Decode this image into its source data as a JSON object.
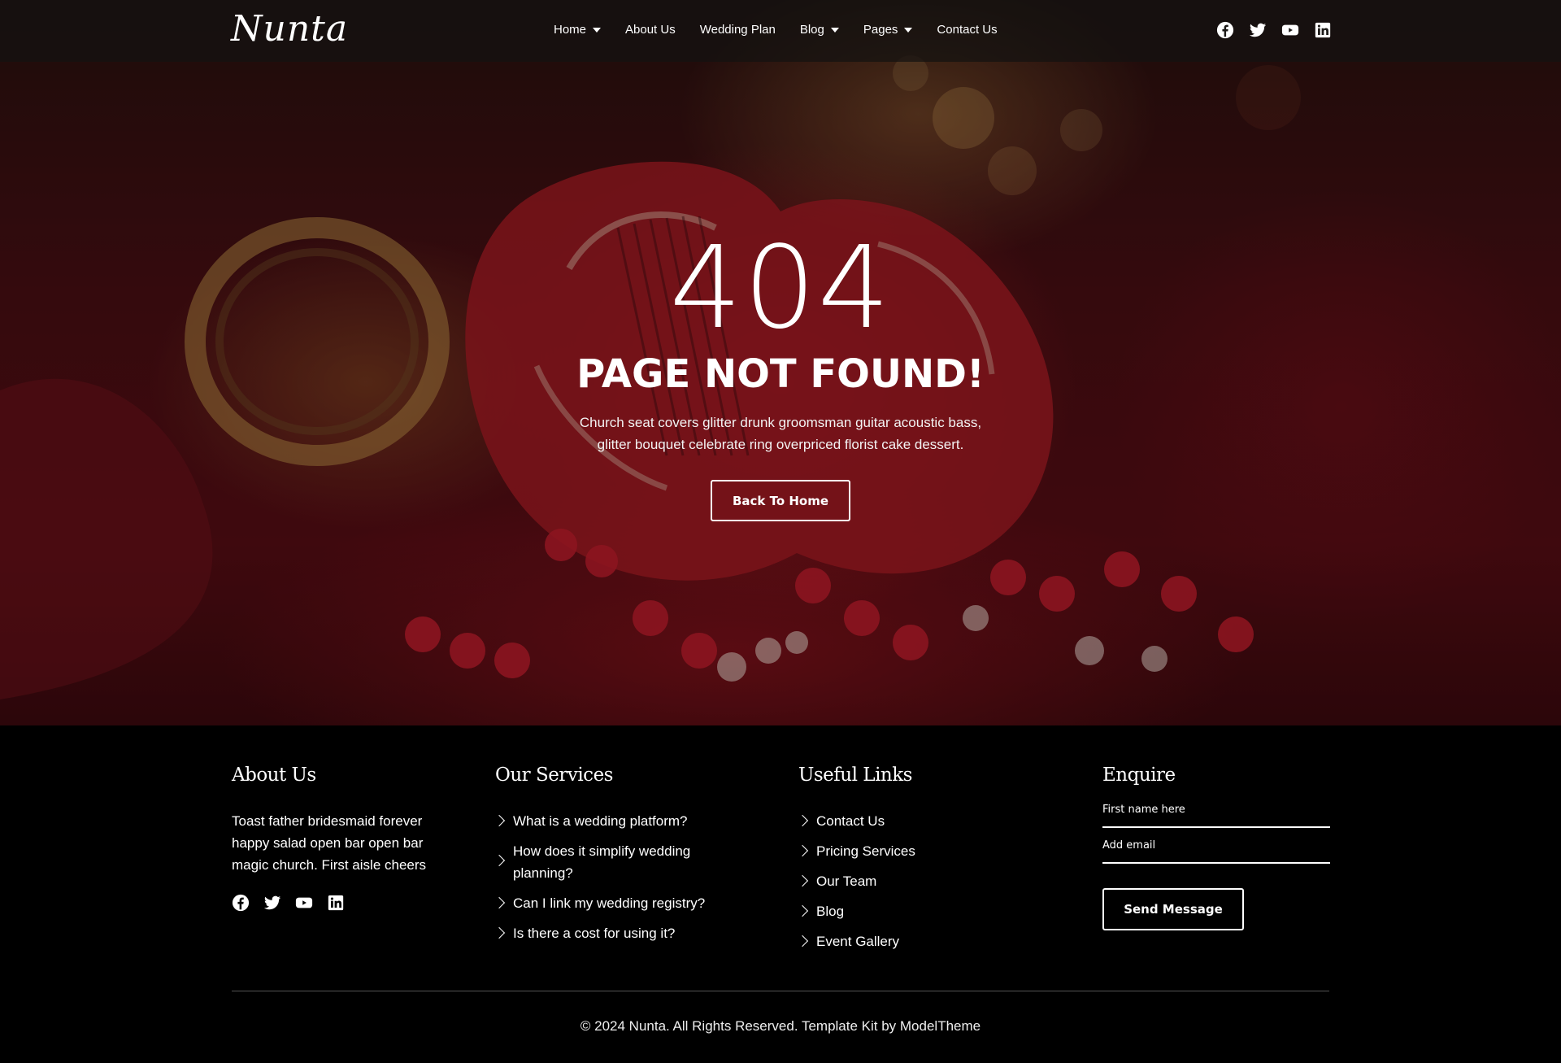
{
  "header": {
    "logo": "Nunta",
    "nav": [
      {
        "label": "Home",
        "has_dropdown": true
      },
      {
        "label": "About Us",
        "has_dropdown": false
      },
      {
        "label": "Wedding Plan",
        "has_dropdown": false
      },
      {
        "label": "Blog",
        "has_dropdown": true
      },
      {
        "label": "Pages",
        "has_dropdown": true
      },
      {
        "label": "Contact Us",
        "has_dropdown": false
      }
    ],
    "social_icons": [
      "facebook-icon",
      "twitter-icon",
      "youtube-icon",
      "linkedin-icon"
    ]
  },
  "hero": {
    "code": "404",
    "title": "PAGE NOT FOUND!",
    "text": "Church seat covers glitter drunk groomsman guitar acoustic bass, glitter bouquet celebrate ring overpriced florist cake dessert.",
    "button": "Back To Home"
  },
  "footer": {
    "about": {
      "heading": "About Us",
      "text": "Toast father bridesmaid forever happy salad open bar open bar magic church. First aisle cheers",
      "social_icons": [
        "facebook-icon",
        "twitter-icon",
        "youtube-icon",
        "linkedin-icon"
      ]
    },
    "services": {
      "heading": "Our Services",
      "items": [
        "What is a wedding platform?",
        "How does it simplify wedding planning?",
        "Can I link my wedding registry?",
        "Is there a cost for using it?"
      ]
    },
    "links": {
      "heading": "Useful Links",
      "items": [
        "Contact Us",
        "Pricing Services",
        "Our Team",
        "Blog",
        "Event Gallery"
      ]
    },
    "enquire": {
      "heading": "Enquire",
      "name_placeholder": "First name here",
      "email_placeholder": "Add email",
      "button": "Send Message"
    },
    "copyright": "© 2024 Nunta. All Rights Reserved. Template Kit by ModelTheme"
  },
  "colors": {
    "background": "#000000",
    "hero_red": "#5b0d15",
    "text": "#ffffff"
  }
}
